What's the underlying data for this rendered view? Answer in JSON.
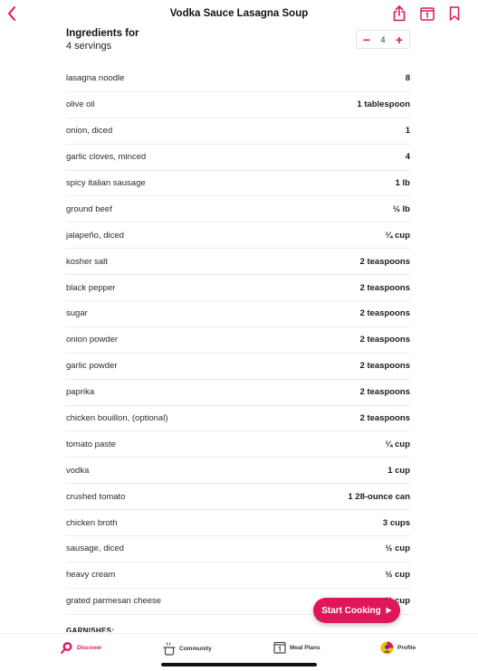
{
  "header": {
    "title": "Vodka Sauce Lasagna Soup"
  },
  "ingredients_section": {
    "title": "Ingredients for",
    "servings_label": "4 servings",
    "servings_value": "4",
    "decrement": "−",
    "increment": "+"
  },
  "ingredients": [
    {
      "name": "lasagna noodle",
      "qty": "8"
    },
    {
      "name": "olive oil",
      "qty": "1 tablespoon"
    },
    {
      "name": "onion, diced",
      "qty": "1"
    },
    {
      "name": "garlic cloves, minced",
      "qty": "4"
    },
    {
      "name": "spicy italian sausage",
      "qty": "1 lb"
    },
    {
      "name": "ground beef",
      "qty": "½ lb"
    },
    {
      "name": "jalapeño, diced",
      "qty": "¼ cup"
    },
    {
      "name": "kosher salt",
      "qty": "2 teaspoons"
    },
    {
      "name": "black pepper",
      "qty": "2 teaspoons"
    },
    {
      "name": "sugar",
      "qty": "2 teaspoons"
    },
    {
      "name": "onion powder",
      "qty": "2 teaspoons"
    },
    {
      "name": "garlic powder",
      "qty": "2 teaspoons"
    },
    {
      "name": "paprika",
      "qty": "2 teaspoons"
    },
    {
      "name": "chicken bouillon, (optional)",
      "qty": "2 teaspoons"
    },
    {
      "name": "tomato paste",
      "qty": "¼ cup"
    },
    {
      "name": "vodka",
      "qty": "1 cup"
    },
    {
      "name": "crushed tomato",
      "qty": "1 28-ounce can"
    },
    {
      "name": "chicken broth",
      "qty": "3 cups"
    },
    {
      "name": "sausage, diced",
      "qty": "½ cup"
    },
    {
      "name": "heavy cream",
      "qty": "½ cup"
    },
    {
      "name": "grated parmesan cheese",
      "qty": "½ cup"
    }
  ],
  "garnishes_label": "GARNISHES:",
  "start_cooking": {
    "label": "Start Cooking"
  },
  "tabs": {
    "discover": "Discover",
    "community": "Community",
    "meal_plans": "Meal Plans",
    "profile": "Profile"
  },
  "colors": {
    "accent": "#e0165b"
  }
}
